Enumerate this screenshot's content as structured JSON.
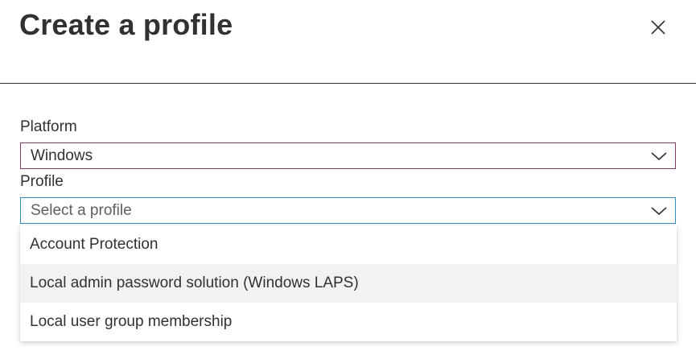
{
  "panel": {
    "title": "Create a profile",
    "close_icon": "close-icon"
  },
  "platform": {
    "label": "Platform",
    "value": "Windows",
    "chevron_icon": "chevron-down-icon"
  },
  "profile": {
    "label": "Profile",
    "placeholder": "Select a profile",
    "chevron_icon": "chevron-down-icon",
    "options": [
      {
        "label": "Account Protection"
      },
      {
        "label": "Local admin password solution (Windows LAPS)"
      },
      {
        "label": "Local user group membership"
      }
    ]
  },
  "colors": {
    "platform_border": "#8a3a6b",
    "profile_border": "#2f8fbf",
    "hover_bg": "#f3f2f1",
    "text": "#323130"
  }
}
